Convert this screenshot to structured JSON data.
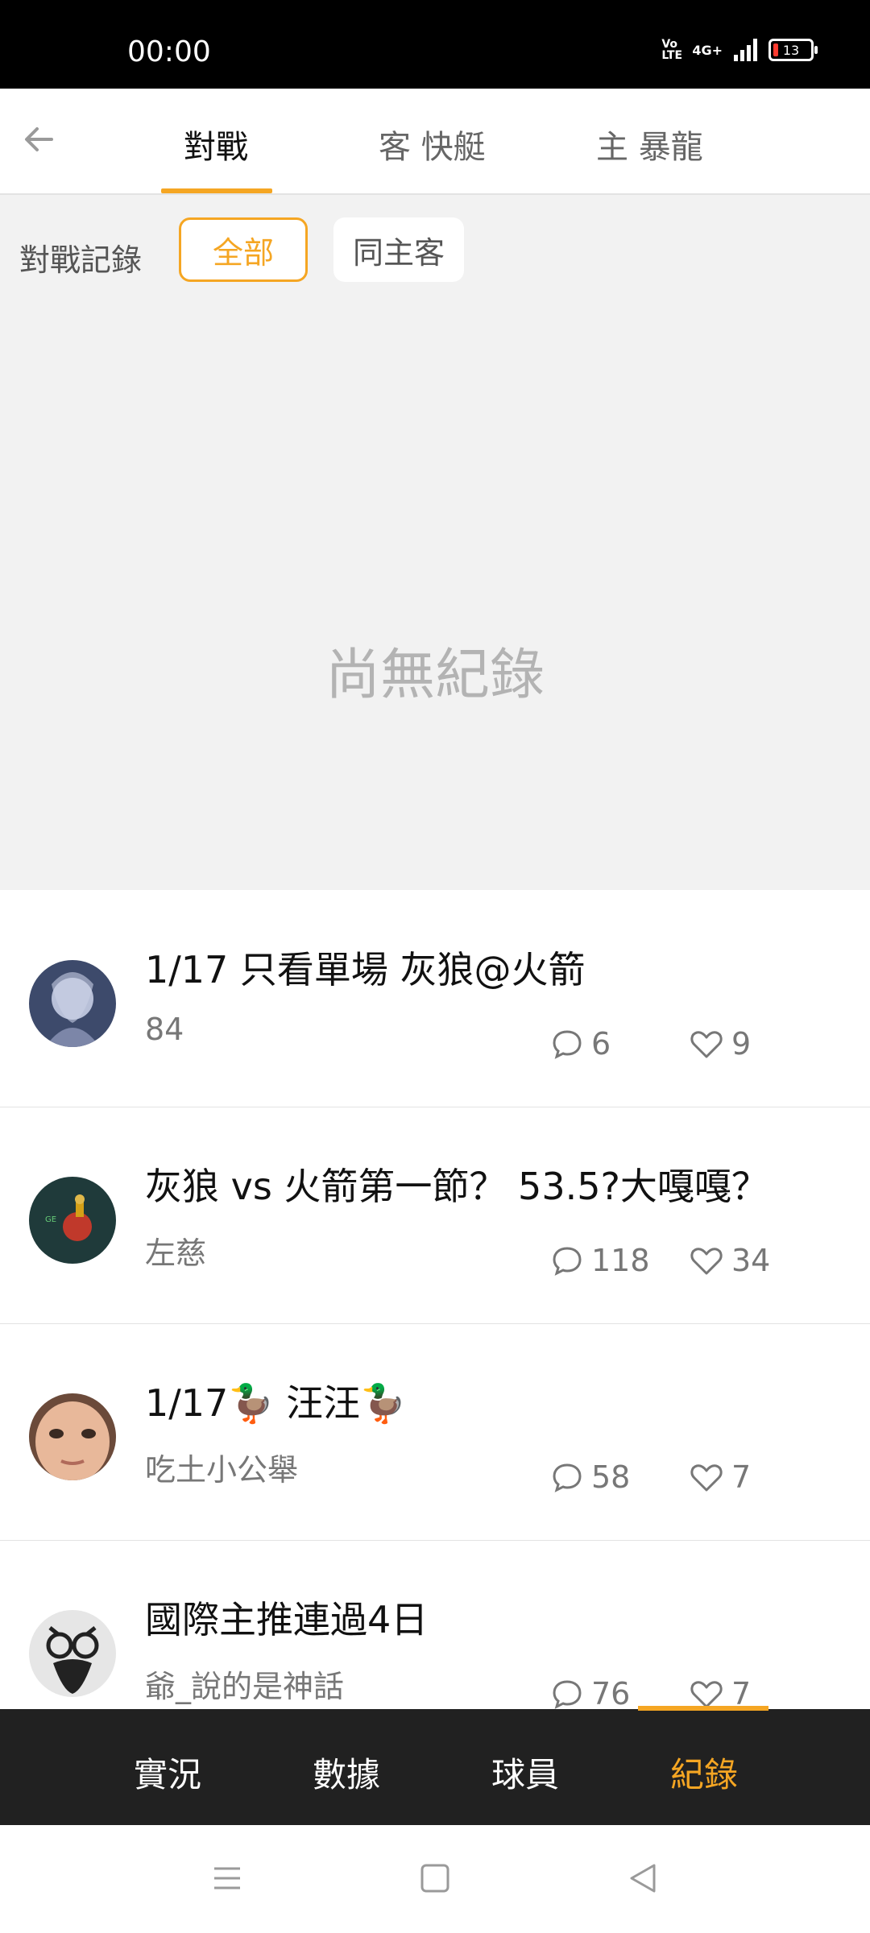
{
  "status_bar": {
    "time": "00:00",
    "network": "4G+",
    "volte": "Vo LTE",
    "battery": "13"
  },
  "top_nav": {
    "tabs": [
      {
        "label": "對戰",
        "active": true
      },
      {
        "label": "客 快艇",
        "active": false
      },
      {
        "label": "主 暴龍",
        "active": false
      }
    ],
    "accent_color": "#f5a623"
  },
  "records": {
    "filter_label": "對戰記錄",
    "chips": [
      {
        "label": "全部",
        "selected": true
      },
      {
        "label": "同主客",
        "selected": false
      }
    ],
    "empty_text": "尚無紀錄"
  },
  "posts": [
    {
      "title": "1/17 只看單場 灰狼@火箭",
      "author": "84",
      "comments": "6",
      "likes": "9"
    },
    {
      "title": "灰狼 vs 火箭第一節？ 53.5?大嘎嘎？",
      "author": "左慈",
      "comments": "118",
      "likes": "34"
    },
    {
      "title": "1/17🦆 汪汪🦆",
      "author": "吃土小公舉",
      "comments": "58",
      "likes": "7"
    },
    {
      "title": "國際主推連過4日",
      "author": "爺_說的是神話",
      "comments": "76",
      "likes": "7"
    }
  ],
  "bottom_tabs": [
    {
      "label": "實況",
      "active": false
    },
    {
      "label": "數據",
      "active": false
    },
    {
      "label": "球員",
      "active": false
    },
    {
      "label": "紀錄",
      "active": true
    }
  ],
  "icons": {
    "back": "back-arrow-icon",
    "comment": "comment-bubble-icon",
    "like": "heart-icon",
    "sys_menu": "menu-icon",
    "sys_home": "home-square-icon",
    "sys_back": "back-triangle-icon"
  }
}
